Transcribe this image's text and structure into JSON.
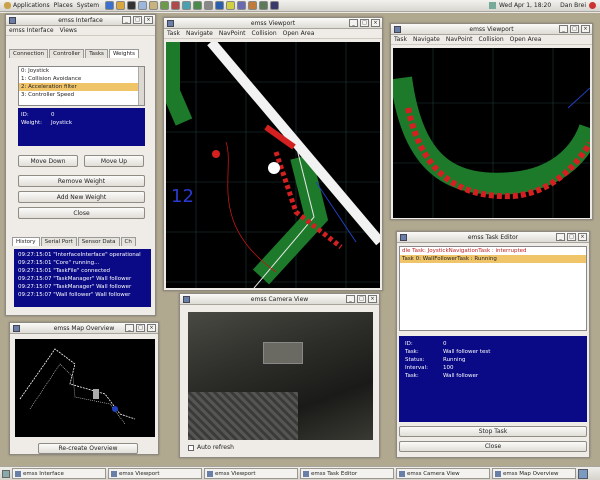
{
  "top_panel": {
    "menus": [
      "Applications",
      "Places",
      "System"
    ],
    "clock": "Wed Apr 1, 18:20",
    "user": "Dan Brei"
  },
  "interface_win": {
    "title": "emss Interface",
    "menus": [
      "emss Interface",
      "Views"
    ],
    "tabs": [
      "Connection",
      "Controller",
      "Tasks",
      "Weights"
    ],
    "weights": [
      "0: Joystick",
      "1: Collision Avoidance",
      "2: Acceleration filter",
      "3: Controller Speed"
    ],
    "info": [
      {
        "k": "ID:",
        "v": "0"
      },
      {
        "k": "Weight:",
        "v": "Joystick"
      }
    ],
    "move_down": "Move Down",
    "move_up": "Move Up",
    "remove": "Remove Weight",
    "add": "Add New Weight",
    "close": "Close",
    "bottom_tabs": [
      "History",
      "Serial Port",
      "Sensor Data",
      "Ch"
    ],
    "history": [
      "09:27:15:01 \"InterfaceInterface\" operational",
      "09:27:15:01 \"Core\" running...",
      "09:27:15:01 \"TaskFile\" connected",
      "09:27:15:07 \"TaskManager\" Wall follower",
      "09:27:15:07 \"TaskManager\" Wall follower",
      "09:27:15:07 \"Wall follower\" Wall follower"
    ]
  },
  "viewport1": {
    "title": "emss Viewport",
    "menus": [
      "Task",
      "Navigate",
      "NavPoint",
      "Collision",
      "Open Area"
    ],
    "label": "12"
  },
  "viewport2": {
    "title": "emss Viewport",
    "menus": [
      "Task",
      "Navigate",
      "NavPoint",
      "Collision",
      "Open Area"
    ]
  },
  "camera_win": {
    "title": "emss Camera View",
    "auto_refresh": "Auto refresh"
  },
  "map_win": {
    "title": "emss Map Overview",
    "recreate_button": "Re-create Overview"
  },
  "task_editor": {
    "title": "emss Task Editor",
    "header": "dle Task: JoystickNavigationTask : interrupted",
    "selected_row": "Task 0: WallFollowerTask : Running",
    "info": [
      {
        "k": "ID:",
        "v": "0"
      },
      {
        "k": "Task:",
        "v": "Wall follower test"
      },
      {
        "k": "Status:",
        "v": "Running"
      },
      {
        "k": "Interval:",
        "v": "100"
      },
      {
        "k": "Task:",
        "v": "Wall follower"
      }
    ],
    "stop": "Stop Task",
    "close": "Close"
  },
  "taskbar": {
    "items": [
      "emss Interface",
      "emss Viewport",
      "emss Viewport",
      "emss Task Editor",
      "emss Camera View",
      "emss Map Overview"
    ]
  },
  "colors": {
    "panel_blue": "#0a0a87",
    "selection": "#f0c56a",
    "path_green": "#1d7a2a",
    "path_red": "#d42020"
  }
}
